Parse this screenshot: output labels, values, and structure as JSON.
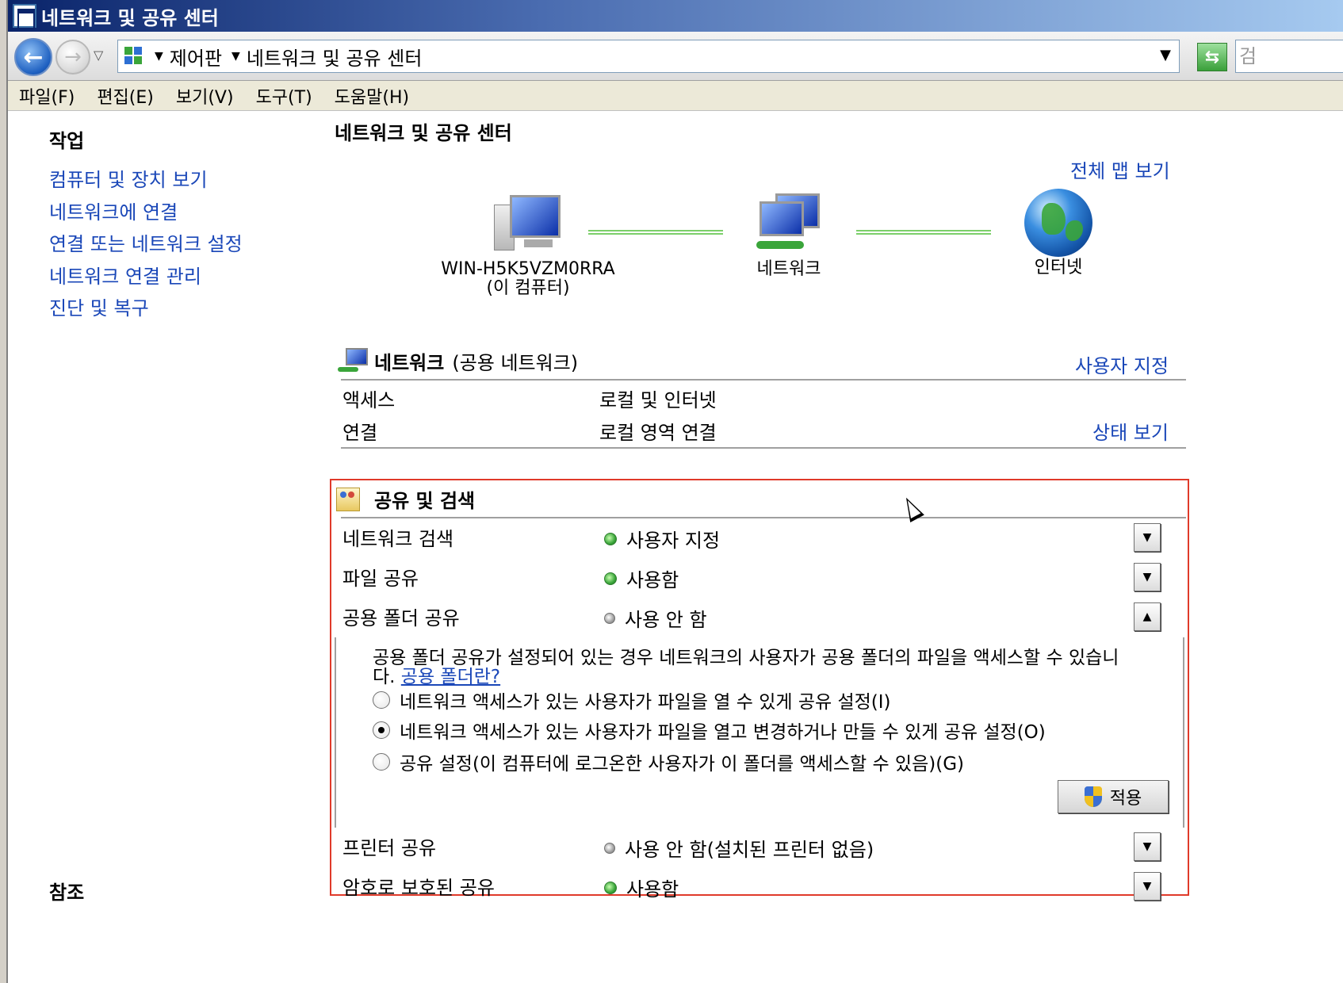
{
  "window": {
    "title": "네트워크 및 공유 센터"
  },
  "address": {
    "crumbs": [
      "제어판",
      "네트워크 및 공유 센터"
    ],
    "search_placeholder": "검"
  },
  "menu": [
    "파일(F)",
    "편집(E)",
    "보기(V)",
    "도구(T)",
    "도움말(H)"
  ],
  "left": {
    "tasks_heading": "작업",
    "links": [
      "컴퓨터 및 장치 보기",
      "네트워크에 연결",
      "연결 또는 네트워크 설정",
      "네트워크 연결 관리",
      "진단 및 복구"
    ],
    "see_also_heading": "참조"
  },
  "main": {
    "title": "네트워크 및 공유 센터",
    "full_map_link": "전체 맵 보기",
    "map": {
      "computer_name": "WIN-H5K5VZM0RRA",
      "computer_sub": "(이 컴퓨터)",
      "network_label": "네트워크",
      "internet_label": "인터넷"
    },
    "network": {
      "name": "네트워크",
      "type": "(공용 네트워크)",
      "customize_link": "사용자 지정",
      "rows": [
        {
          "label": "액세스",
          "value": "로컬 및 인터넷"
        },
        {
          "label": "연결",
          "value": "로컬 영역 연결",
          "link": "상태 보기"
        }
      ]
    },
    "sharing": {
      "heading": "공유 및 검색",
      "rows": [
        {
          "label": "네트워크 검색",
          "value": "사용자 지정",
          "status": "on"
        },
        {
          "label": "파일 공유",
          "value": "사용함",
          "status": "on"
        },
        {
          "label": "공용 폴더 공유",
          "value": "사용 안 함",
          "status": "off"
        },
        {
          "label": "프린터 공유",
          "value": "사용 안 함(설치된 프린터 없음)",
          "status": "off"
        },
        {
          "label": "암호로 보호된 공유",
          "value": "사용함",
          "status": "on"
        }
      ],
      "public_folder_detail": {
        "description": "공용 폴더 공유가 설정되어 있는 경우 네트워크의 사용자가 공용 폴더의 파일을 액세스할 수 있습니다.",
        "description_line1": "공용 폴더 공유가 설정되어 있는 경우 네트워크의 사용자가 공용 폴더의 파일을 액세스할 수 있습니",
        "description_line2": "다.",
        "help_link": "공용 폴더란?",
        "options": [
          {
            "label": "네트워크 액세스가 있는 사용자가 파일을 열 수 있게 공유 설정(I)",
            "checked": false
          },
          {
            "label": "네트워크 액세스가 있는 사용자가 파일을 열고 변경하거나 만들 수 있게 공유 설정(O)",
            "checked": true
          },
          {
            "label": "공유 설정(이 컴퓨터에 로그온한 사용자가 이 폴더를 액세스할 수 있음)(G)",
            "checked": false
          }
        ],
        "apply_label": "적용"
      }
    }
  },
  "colors": {
    "link": "#1a47b8",
    "highlight_border": "#e03a2a",
    "status_on": "#3aa53a"
  }
}
